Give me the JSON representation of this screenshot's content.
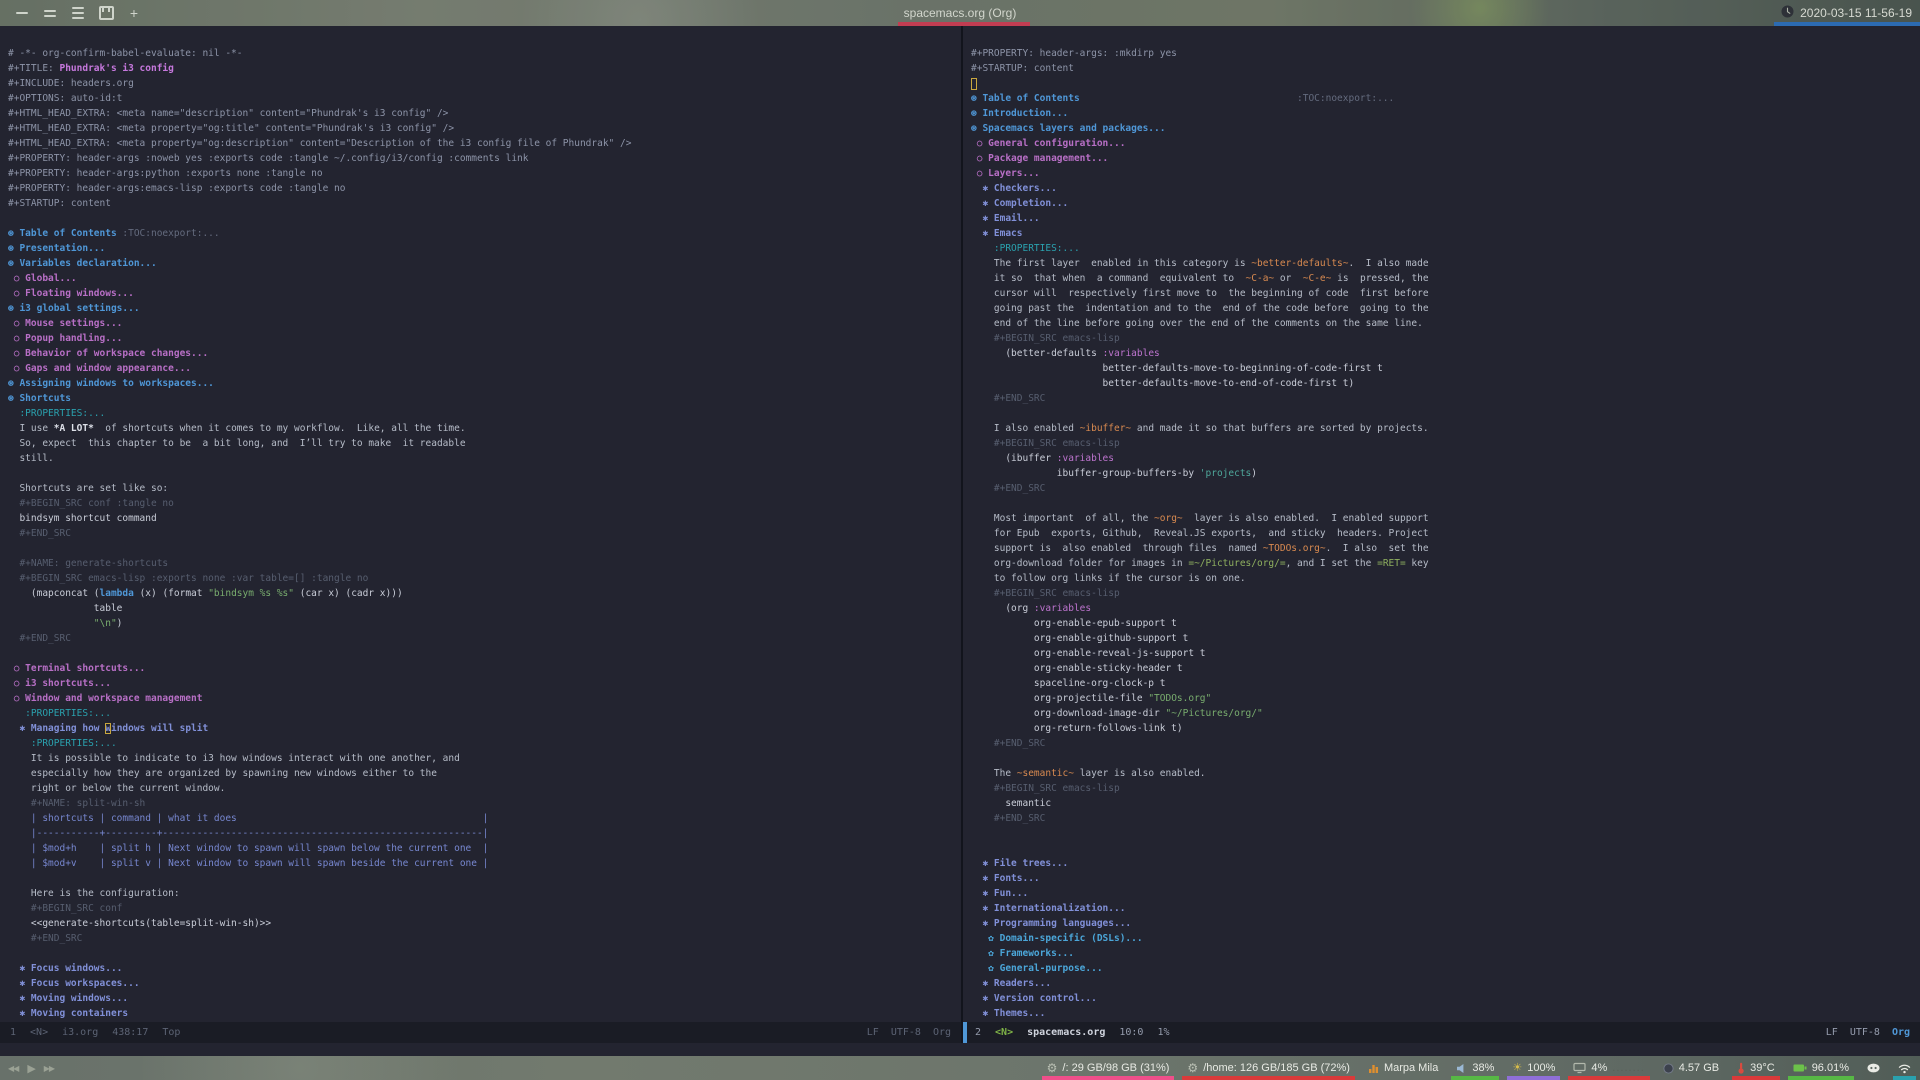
{
  "titlebar": {
    "workspaces": [
      {
        "name": "workspace-one",
        "shape": "bars1"
      },
      {
        "name": "workspace-two",
        "shape": "bars2"
      },
      {
        "name": "workspace-three",
        "shape": "bars3"
      },
      {
        "name": "workspace-four",
        "shape": "box"
      },
      {
        "name": "workspace-add",
        "shape": "plus",
        "glyph": "+"
      }
    ],
    "title": "spacemacs.org (Org)",
    "clock": "2020-03-15 11-56-19",
    "active_underline_color": "#c23d52",
    "clock_underline_color": "#2c6bb2"
  },
  "left_buffer": {
    "lines": [
      [
        [
          "meta",
          "# -*- org-confirm-babel-evaluate: nil -*-"
        ]
      ],
      [
        [
          "meta",
          "#+TITLE: "
        ],
        [
          "title",
          "Phundrak's i3 config"
        ]
      ],
      [
        [
          "meta",
          "#+INCLUDE: headers.org"
        ]
      ],
      [
        [
          "meta",
          "#+OPTIONS: auto-id:t"
        ]
      ],
      [
        [
          "meta",
          "#+HTML_HEAD_EXTRA: <meta name=\"description\" content=\"Phundrak's i3 config\" />"
        ]
      ],
      [
        [
          "meta",
          "#+HTML_HEAD_EXTRA: <meta property=\"og:title\" content=\"Phundrak's i3 config\" />"
        ]
      ],
      [
        [
          "meta",
          "#+HTML_HEAD_EXTRA: <meta property=\"og:description\" content=\"Description of the i3 config file of Phundrak\" />"
        ]
      ],
      [
        [
          "meta",
          "#+PROPERTY: header-args :noweb yes :exports code :tangle ~/.config/i3/config :comments link"
        ]
      ],
      [
        [
          "meta",
          "#+PROPERTY: header-args:python :exports none :tangle no"
        ]
      ],
      [
        [
          "meta",
          "#+PROPERTY: header-args:emacs-lisp :exports code :tangle no"
        ]
      ],
      [
        [
          "meta",
          "#+STARTUP: content"
        ]
      ],
      [],
      [
        [
          "h1",
          "⊛ Table of Contents"
        ],
        [
          "tag",
          " :TOC:noexport:..."
        ]
      ],
      [
        [
          "h1",
          "⊛ Presentation..."
        ]
      ],
      [
        [
          "h1",
          "⊛ Variables declaration..."
        ]
      ],
      [
        [
          "h2",
          " ○ Global..."
        ]
      ],
      [
        [
          "h2",
          " ○ Floating windows..."
        ]
      ],
      [
        [
          "h1",
          "⊛ i3 global settings..."
        ]
      ],
      [
        [
          "h2",
          " ○ Mouse settings..."
        ]
      ],
      [
        [
          "h2",
          " ○ Popup handling..."
        ]
      ],
      [
        [
          "h2",
          " ○ Behavior of workspace changes..."
        ]
      ],
      [
        [
          "h2",
          " ○ Gaps and window appearance..."
        ]
      ],
      [
        [
          "h1",
          "⊛ Assigning windows to workspaces..."
        ]
      ],
      [
        [
          "h1",
          "⊛ Shortcuts"
        ]
      ],
      [
        [
          "drawer",
          "  :PROPERTIES:..."
        ]
      ],
      [
        [
          "text",
          "  I use "
        ],
        [
          "bold",
          "*A LOT*"
        ],
        [
          "text",
          "  of shortcuts when it comes to my workflow.  Like, all the time."
        ]
      ],
      [
        [
          "text",
          "  So, expect  this chapter to be  a bit long, and  I’ll try to make  it readable"
        ]
      ],
      [
        [
          "text",
          "  still."
        ]
      ],
      [],
      [
        [
          "text",
          "  Shortcuts are set like so:"
        ]
      ],
      [
        [
          "srcmeta",
          "  #+BEGIN_SRC conf :tangle no"
        ]
      ],
      [
        [
          "code",
          "  bindsym shortcut command"
        ]
      ],
      [
        [
          "srcmeta",
          "  #+END_SRC"
        ]
      ],
      [],
      [
        [
          "srcmeta",
          "  #+NAME: generate-shortcuts"
        ]
      ],
      [
        [
          "srcmeta",
          "  #+BEGIN_SRC emacs-lisp :exports none :var table=[] :tangle no"
        ]
      ],
      [
        [
          "code",
          "    (mapconcat ("
        ],
        [
          "kw",
          "lambda"
        ],
        [
          "code",
          " (x) (format "
        ],
        [
          "string",
          "\"bindsym %s %s\""
        ],
        [
          "code",
          " (car x) (cadr x)))"
        ]
      ],
      [
        [
          "code",
          "               table"
        ]
      ],
      [
        [
          "string",
          "               \"\\n\""
        ],
        [
          "code",
          ")"
        ]
      ],
      [
        [
          "srcmeta",
          "  #+END_SRC"
        ]
      ],
      [],
      [
        [
          "h2",
          " ○ Terminal shortcuts..."
        ]
      ],
      [
        [
          "h2",
          " ○ i3 shortcuts..."
        ]
      ],
      [
        [
          "h2",
          " ○ Window and workspace management"
        ]
      ],
      [
        [
          "drawer",
          "   :PROPERTIES:..."
        ]
      ],
      [
        [
          "h3",
          "  ✱ Managing how "
        ],
        [
          "h3cursor",
          "w"
        ],
        [
          "h3",
          "indows will split"
        ]
      ],
      [
        [
          "drawer",
          "    :PROPERTIES:..."
        ]
      ],
      [
        [
          "text",
          "    It is possible to indicate to i3 how windows interact with one another, and"
        ]
      ],
      [
        [
          "text",
          "    especially how they are organized by spawning new windows either to the"
        ]
      ],
      [
        [
          "text",
          "    right or below the current window."
        ]
      ],
      [
        [
          "srcmeta",
          "    #+NAME: split-win-sh"
        ]
      ],
      [
        [
          "table",
          "    | shortcuts | command | what it does                                           |"
        ]
      ],
      [
        [
          "table",
          "    |-----------+---------+--------------------------------------------------------|"
        ]
      ],
      [
        [
          "table",
          "    | $mod+h    | split h | Next window to spawn will spawn below the current one  |"
        ]
      ],
      [
        [
          "table",
          "    | $mod+v    | split v | Next window to spawn will spawn beside the current one |"
        ]
      ],
      [],
      [
        [
          "text",
          "    Here is the configuration:"
        ]
      ],
      [
        [
          "srcmeta",
          "    #+BEGIN_SRC conf"
        ]
      ],
      [
        [
          "code",
          "    <<generate-shortcuts(table=split-win-sh)>>"
        ]
      ],
      [
        [
          "srcmeta",
          "    #+END_SRC"
        ]
      ],
      [],
      [
        [
          "h3",
          "  ✱ Focus windows..."
        ]
      ],
      [
        [
          "h3",
          "  ✱ Focus workspaces..."
        ]
      ],
      [
        [
          "h3",
          "  ✱ Moving windows..."
        ]
      ],
      [
        [
          "h3",
          "  ✱ Moving containers"
        ]
      ]
    ]
  },
  "right_buffer": {
    "lines": [
      [
        [
          "meta",
          "#+PROPERTY: header-args: :mkdirp yes"
        ]
      ],
      [
        [
          "meta",
          "#+STARTUP: content"
        ]
      ],
      [
        [
          "cursor",
          " "
        ]
      ],
      [
        [
          "h1",
          "⊛ Table of Contents"
        ],
        [
          "tag",
          "                                      :TOC:noexport:..."
        ]
      ],
      [
        [
          "h1",
          "⊛ Introduction..."
        ]
      ],
      [
        [
          "h1",
          "⊛ Spacemacs layers and packages..."
        ]
      ],
      [
        [
          "h2",
          " ○ General configuration..."
        ]
      ],
      [
        [
          "h2",
          " ○ Package management..."
        ]
      ],
      [
        [
          "h2",
          " ○ Layers..."
        ]
      ],
      [
        [
          "h3",
          "  ✱ Checkers..."
        ]
      ],
      [
        [
          "h3",
          "  ✱ Completion..."
        ]
      ],
      [
        [
          "h3",
          "  ✱ Email..."
        ]
      ],
      [
        [
          "h3",
          "  ✱ Emacs"
        ]
      ],
      [
        [
          "drawer",
          "    :PROPERTIES:..."
        ]
      ],
      [
        [
          "text",
          "    The first layer  enabled in this category is "
        ],
        [
          "codei",
          "~better-defaults~"
        ],
        [
          "text",
          ".  I also made"
        ]
      ],
      [
        [
          "text",
          "    it so  that when  a command  equivalent to  "
        ],
        [
          "codei",
          "~C-a~"
        ],
        [
          "text",
          " or  "
        ],
        [
          "codei",
          "~C-e~"
        ],
        [
          "text",
          " is  pressed, the"
        ]
      ],
      [
        [
          "text",
          "    cursor will  respectively first move to  the beginning of code  first before"
        ]
      ],
      [
        [
          "text",
          "    going past the  indentation and to the  end of the code before  going to the"
        ]
      ],
      [
        [
          "text",
          "    end of the line before going over the end of the comments on the same line."
        ]
      ],
      [
        [
          "srcmeta",
          "    #+BEGIN_SRC emacs-lisp"
        ]
      ],
      [
        [
          "code",
          "      (better-defaults "
        ],
        [
          "builtin",
          ":variables"
        ]
      ],
      [
        [
          "code",
          "                       better-defaults-move-to-beginning-of-code-first t"
        ]
      ],
      [
        [
          "code",
          "                       better-defaults-move-to-end-of-code-first t)"
        ]
      ],
      [
        [
          "srcmeta",
          "    #+END_SRC"
        ]
      ],
      [],
      [
        [
          "text",
          "    I also enabled "
        ],
        [
          "codei",
          "~ibuffer~"
        ],
        [
          "text",
          " and made it so that buffers are sorted by projects."
        ]
      ],
      [
        [
          "srcmeta",
          "    #+BEGIN_SRC emacs-lisp"
        ]
      ],
      [
        [
          "code",
          "      (ibuffer "
        ],
        [
          "builtin",
          ":variables"
        ]
      ],
      [
        [
          "code",
          "               ibuffer-group-buffers-by "
        ],
        [
          "symbol",
          "'projects"
        ],
        [
          "code",
          ")"
        ]
      ],
      [
        [
          "srcmeta",
          "    #+END_SRC"
        ]
      ],
      [],
      [
        [
          "text",
          "    Most important  of all, the "
        ],
        [
          "codei",
          "~org~"
        ],
        [
          "text",
          "  layer is also enabled.  I enabled support"
        ]
      ],
      [
        [
          "text",
          "    for Epub  exports, Github,  Reveal.JS exports,  and sticky  headers. Project"
        ]
      ],
      [
        [
          "text",
          "    support is  also enabled  through files  named "
        ],
        [
          "codei",
          "~TODOs.org~"
        ],
        [
          "text",
          ".  I also  set the"
        ]
      ],
      [
        [
          "text",
          "    org-download folder for images in "
        ],
        [
          "verb",
          "=~/Pictures/org/="
        ],
        [
          "text",
          ", and I set the "
        ],
        [
          "verb",
          "=RET="
        ],
        [
          "text",
          " key"
        ]
      ],
      [
        [
          "text",
          "    to follow org links if the cursor is on one."
        ]
      ],
      [
        [
          "srcmeta",
          "    #+BEGIN_SRC emacs-lisp"
        ]
      ],
      [
        [
          "code",
          "      (org "
        ],
        [
          "builtin",
          ":variables"
        ]
      ],
      [
        [
          "code",
          "           org-enable-epub-support t"
        ]
      ],
      [
        [
          "code",
          "           org-enable-github-support t"
        ]
      ],
      [
        [
          "code",
          "           org-enable-reveal-js-support t"
        ]
      ],
      [
        [
          "code",
          "           org-enable-sticky-header t"
        ]
      ],
      [
        [
          "code",
          "           spaceline-org-clock-p t"
        ]
      ],
      [
        [
          "code",
          "           org-projectile-file "
        ],
        [
          "string",
          "\"TODOs.org\""
        ]
      ],
      [
        [
          "code",
          "           org-download-image-dir "
        ],
        [
          "string",
          "\"~/Pictures/org/\""
        ]
      ],
      [
        [
          "code",
          "           org-return-follows-link t)"
        ]
      ],
      [
        [
          "srcmeta",
          "    #+END_SRC"
        ]
      ],
      [],
      [
        [
          "text",
          "    The "
        ],
        [
          "codei",
          "~semantic~"
        ],
        [
          "text",
          " layer is also enabled."
        ]
      ],
      [
        [
          "srcmeta",
          "    #+BEGIN_SRC emacs-lisp"
        ]
      ],
      [
        [
          "code",
          "      semantic"
        ]
      ],
      [
        [
          "srcmeta",
          "    #+END_SRC"
        ]
      ],
      [],
      [],
      [
        [
          "h3",
          "  ✱ File trees..."
        ]
      ],
      [
        [
          "h3",
          "  ✱ Fonts..."
        ]
      ],
      [
        [
          "h3",
          "  ✱ Fun..."
        ]
      ],
      [
        [
          "h3",
          "  ✱ Internationalization..."
        ]
      ],
      [
        [
          "h3",
          "  ✱ Programming languages..."
        ]
      ],
      [
        [
          "h4",
          "   ✿ Domain-specific (DSLs)..."
        ]
      ],
      [
        [
          "h4",
          "   ✿ Frameworks..."
        ]
      ],
      [
        [
          "h4",
          "   ✿ General-purpose..."
        ]
      ],
      [
        [
          "h3",
          "  ✱ Readers..."
        ]
      ],
      [
        [
          "h3",
          "  ✱ Version control..."
        ]
      ],
      [
        [
          "h3",
          "  ✱ Themes..."
        ]
      ]
    ]
  },
  "left_modeline": {
    "window_number": "1",
    "state": "<N>",
    "buffer_name": "i3.org",
    "position": "438:17",
    "scroll": "Top",
    "eol": "LF",
    "encoding": "UTF-8",
    "mode": "Org"
  },
  "right_modeline": {
    "window_number": "2",
    "state": "<N>",
    "buffer_name": "spacemacs.org",
    "position": "10:0",
    "scroll": "1%",
    "eol": "LF",
    "encoding": "UTF-8",
    "mode": "Org",
    "accent_color": "#4f97d7"
  },
  "tray": {
    "media": [
      {
        "name": "previous-track-icon",
        "glyph": "◀◀",
        "cls": "m-icon"
      },
      {
        "name": "play-icon",
        "glyph": "▶",
        "cls": "m-icon m-play"
      },
      {
        "name": "next-track-icon",
        "glyph": "▶▶",
        "cls": "m-icon"
      }
    ],
    "modules": [
      {
        "name": "disk-root",
        "icon": "gear-icon",
        "text": "/: 29 GB/98 GB (31%)",
        "accent": "#ef4f8a"
      },
      {
        "name": "disk-home",
        "icon": "gear-icon",
        "text": "/home: 126 GB/185 GB (72%)",
        "accent": "#da3a3a"
      },
      {
        "name": "now-playing",
        "icon": "music-icon",
        "text": "Marpa Mila",
        "accent": ""
      },
      {
        "name": "volume",
        "icon": "speaker-icon",
        "text": "38%",
        "accent": "#57b845"
      },
      {
        "name": "brightness",
        "icon": "brightness-icon",
        "text": "100%",
        "accent": "#8f6fd8"
      },
      {
        "name": "cpu",
        "icon": "cpu-icon",
        "text": "4%",
        "suffix": "........",
        "accent": "#da3a3a"
      },
      {
        "name": "memory",
        "icon": "memory-icon",
        "text": "4.57 GB",
        "accent": ""
      },
      {
        "name": "temperature",
        "icon": "thermometer-icon",
        "text": "39°C",
        "accent": "#da3a3a"
      },
      {
        "name": "battery",
        "icon": "battery-icon",
        "text": "96.01%",
        "accent": "#57b845"
      },
      {
        "name": "discord",
        "icon": "discord-icon",
        "text": "",
        "accent": ""
      },
      {
        "name": "wifi",
        "icon": "wifi-icon",
        "text": "",
        "accent": "#2aa1ae"
      }
    ]
  }
}
